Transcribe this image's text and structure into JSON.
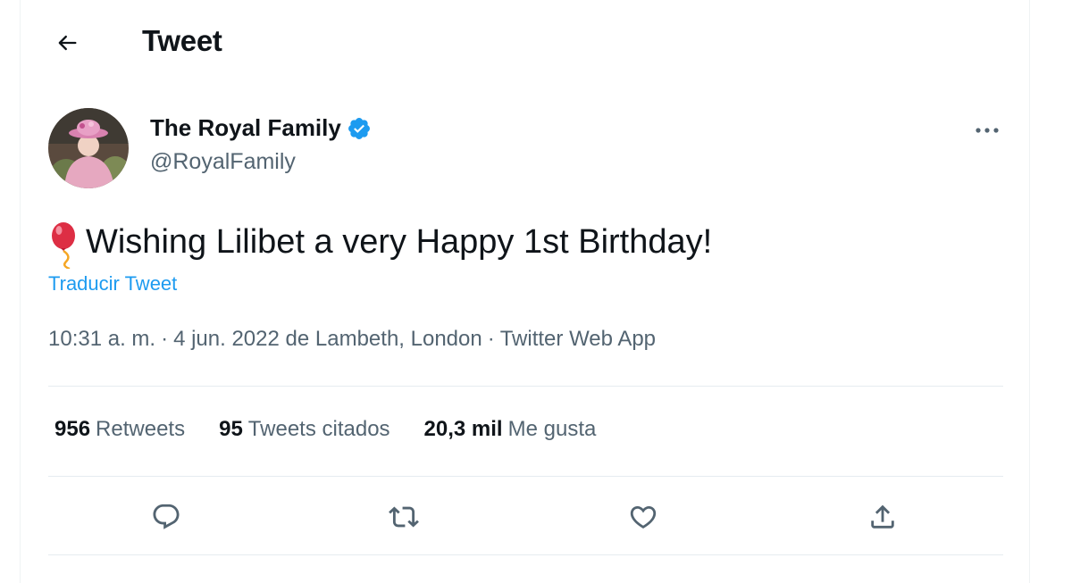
{
  "header": {
    "back_icon": "arrow-left-icon",
    "title": "Tweet"
  },
  "author": {
    "name": "The Royal Family",
    "handle": "@RoyalFamily",
    "verified_icon": "verified-badge-icon",
    "verified_color": "#1d9bf0"
  },
  "tweet": {
    "emoji_icon": "balloon-icon",
    "text": "Wishing Lilibet a very Happy 1st Birthday!",
    "translate_label": "Traducir Tweet",
    "time": "10:31 a. m.",
    "date": "4 jun. 2022",
    "location": "de Lambeth, London",
    "source": "Twitter Web App"
  },
  "stats": [
    {
      "count": "956",
      "label": "Retweets"
    },
    {
      "count": "95",
      "label": "Tweets citados"
    },
    {
      "count": "20,3 mil",
      "label": "Me gusta"
    }
  ],
  "actions": [
    "reply-icon",
    "retweet-icon",
    "like-icon",
    "share-icon"
  ],
  "colors": {
    "accent": "#1d9bf0",
    "text_primary": "#0f1419",
    "text_secondary": "#536471"
  }
}
